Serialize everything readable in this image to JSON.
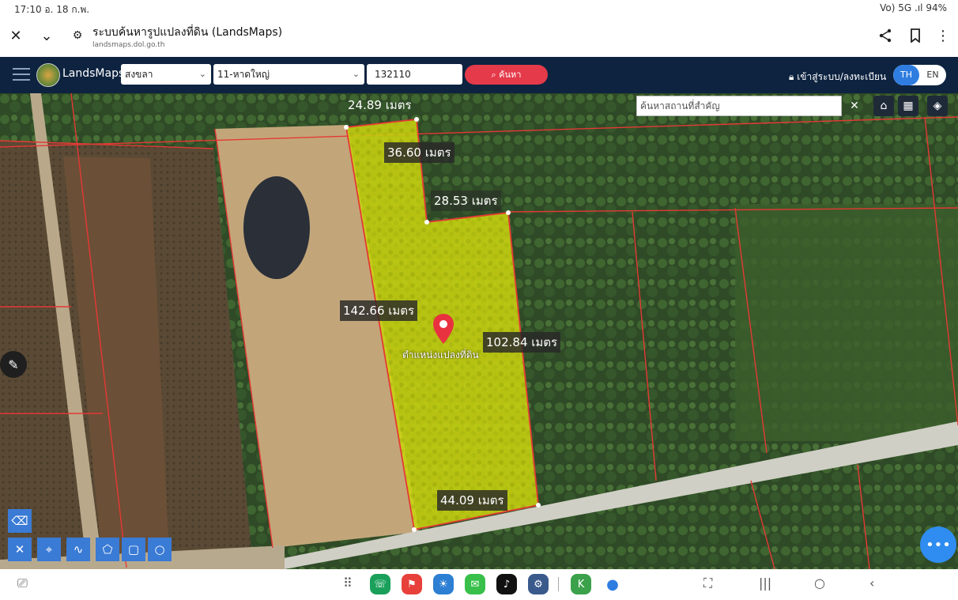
{
  "status_bar": {
    "time_date": "17:10  อ. 18 ก.พ.",
    "indicators": "Vo) 5G .ıl 94%"
  },
  "browser": {
    "title": "ระบบค้นหารูปแปลงที่ดิน (LandsMaps)",
    "url": "landsmaps.dol.go.th"
  },
  "app_bar": {
    "brand": "LandsMaps",
    "province": "สงขลา",
    "district": "11-หาดใหญ่",
    "parcel_number": "132110",
    "search_label": "ค้นหา",
    "login_label": "เข้าสู่ระบบ/ลงทะเบียน",
    "lang_th": "TH",
    "lang_en": "EN"
  },
  "map": {
    "place_search_placeholder": "ค้นหาสถานที่สำคัญ",
    "measurements": {
      "top": "24.89 เมตร",
      "notch_vertical": "36.60 เมตร",
      "notch_horizontal": "28.53 เมตร",
      "left_side": "142.66 เมตร",
      "right_side": "102.84 เมตร",
      "bottom": "44.09 เมตร"
    },
    "pin_label": "ตำแหน่งแปลงที่ดิน",
    "parcel_color": "#c8d40a",
    "boundary_color": "#e53935"
  },
  "dock": {
    "apps": [
      "phone",
      "flag",
      "weather",
      "line",
      "tiktok",
      "settings",
      "kasikorn",
      "messages"
    ]
  }
}
